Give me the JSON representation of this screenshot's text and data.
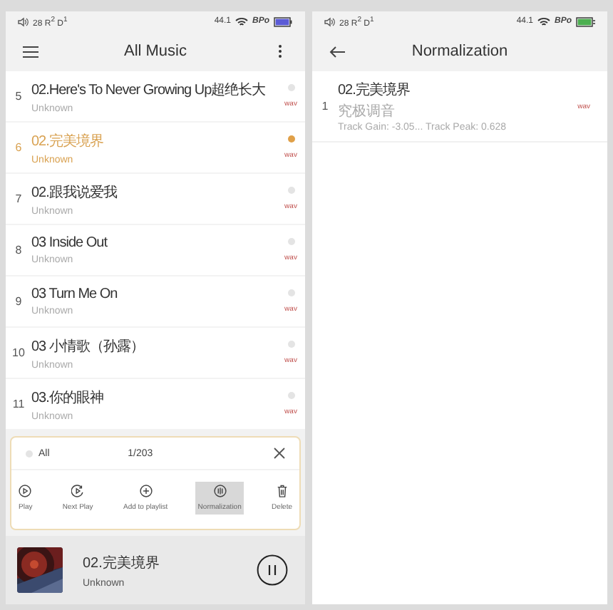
{
  "left_screen": {
    "status_bar": {
      "indicators": "28 R$^{2}$ D$^{1}$",
      "sample_rate": "44.1",
      "badge": "BPo",
      "charging": false
    },
    "header": {
      "title": "All Music"
    },
    "tracks": [
      {
        "number": "5",
        "title": "02.Here's To Never Growing Up超绝长大",
        "artist": "Unknown",
        "format": "wav",
        "selected": false
      },
      {
        "number": "6",
        "title": "02.完美境界",
        "artist": "Unknown",
        "format": "wav",
        "selected": true
      },
      {
        "number": "7",
        "title": "02.跟我说爱我",
        "artist": "Unknown",
        "format": "wav",
        "selected": false
      },
      {
        "number": "8",
        "title": "03 Inside Out",
        "artist": "Unknown",
        "format": "wav",
        "selected": false
      },
      {
        "number": "9",
        "title": "03 Turn Me On",
        "artist": "Unknown",
        "format": "wav",
        "selected": false
      },
      {
        "number": "10",
        "title": "03 小情歌（孙露）",
        "artist": "Unknown",
        "format": "wav",
        "selected": false
      },
      {
        "number": "11",
        "title": "03.你的眼神",
        "artist": "Unknown",
        "format": "wav",
        "selected": false
      }
    ],
    "selection_bar": {
      "select_all": {
        "label": "All",
        "checked": false
      },
      "count": "1/203",
      "actions": [
        {
          "label": "Play",
          "kind": "play",
          "selected": false
        },
        {
          "label": "Next Play",
          "kind": "next",
          "selected": false
        },
        {
          "label": "Add to playlist",
          "kind": "add",
          "selected": false
        },
        {
          "label": "Normalization",
          "kind": "normalize",
          "selected": true
        },
        {
          "label": "Delete",
          "kind": "delete",
          "selected": false
        }
      ]
    },
    "now_playing": {
      "title": "02.完美境界",
      "artist": "Unknown",
      "playing": true
    }
  },
  "right_screen": {
    "status_bar": {
      "indicators": "28 R$^{2}$ D$^{1}$",
      "sample_rate": "44.1",
      "badge": "BPo",
      "charging": true
    },
    "header": {
      "title": "Normalization"
    },
    "items": [
      {
        "number": "1",
        "title": "02.完美境界",
        "album": "究极调音",
        "info": "Track Gain: -3.05... Track Peak: 0.628",
        "format": "wav"
      }
    ]
  }
}
